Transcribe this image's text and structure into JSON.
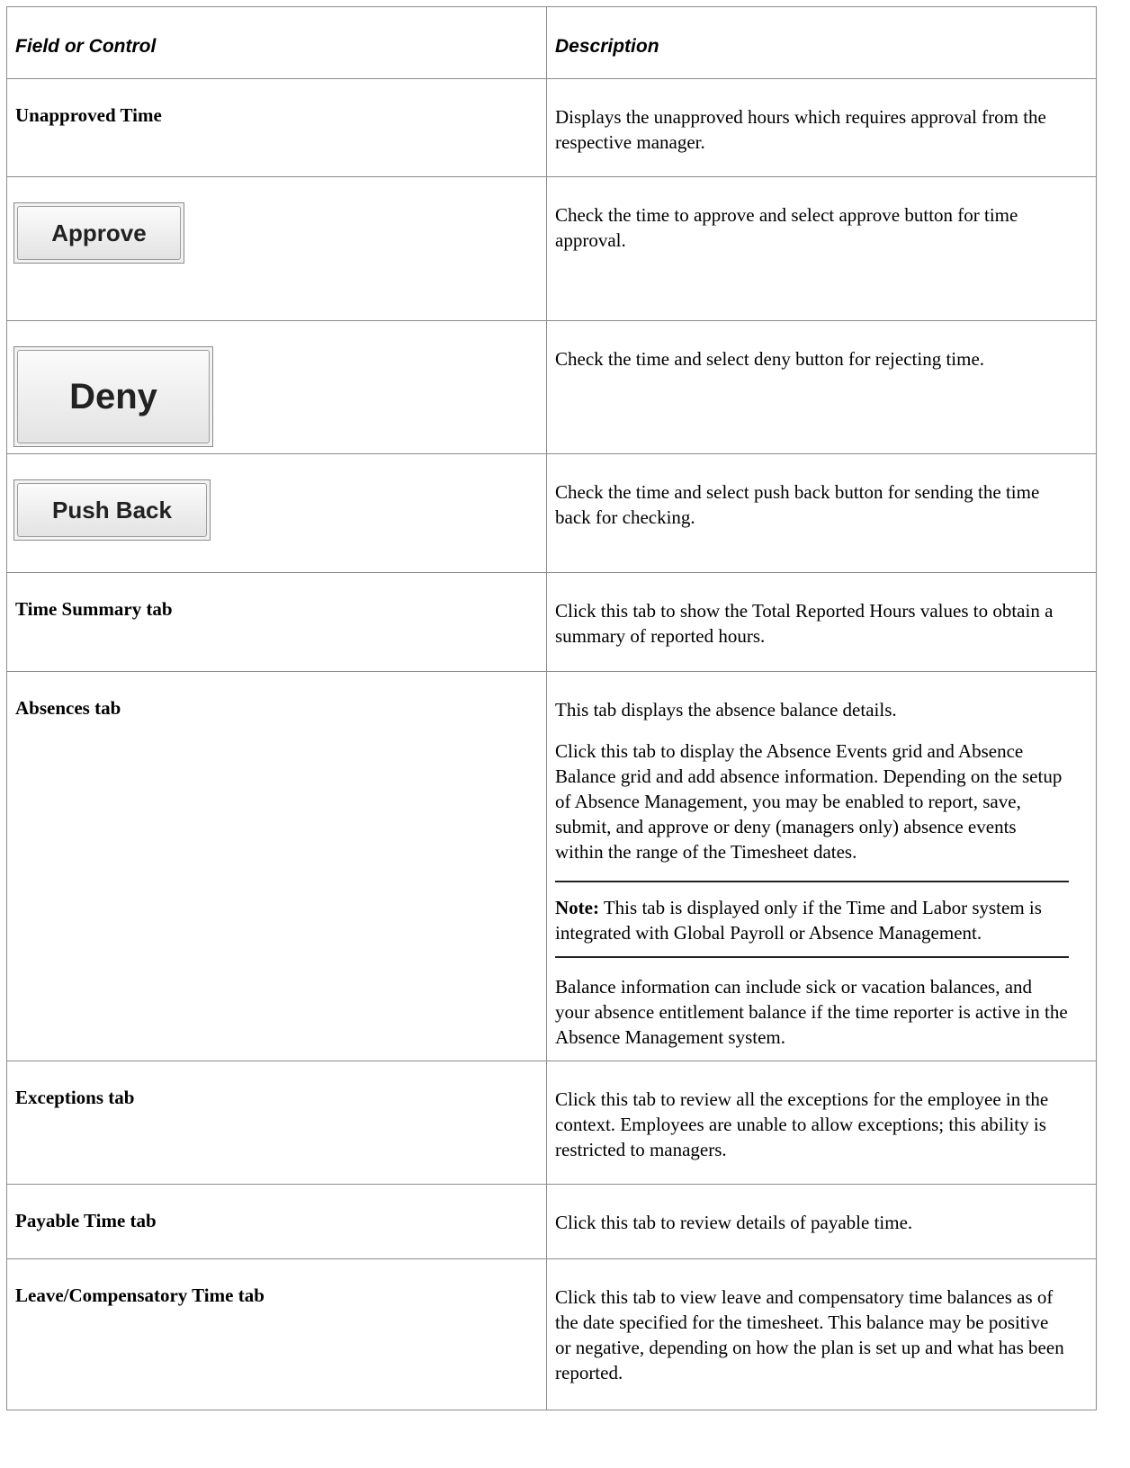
{
  "header": {
    "field": "Field or Control",
    "description": "Description"
  },
  "rows": [
    {
      "field": "Unapproved Time",
      "description": [
        "Displays the unapproved hours which requires approval from the respective manager."
      ]
    },
    {
      "button": "Approve",
      "description": [
        "Check the time to approve and select approve button for time approval."
      ]
    },
    {
      "button": "Deny",
      "description": [
        "Check the time and select deny button for rejecting time."
      ]
    },
    {
      "button": "Push Back",
      "description": [
        "Check the time and select push back button for sending the time back for checking."
      ]
    },
    {
      "field": "Time Summary tab",
      "description": [
        "Click this tab to show the Total Reported Hours values to obtain a summary of reported hours."
      ]
    },
    {
      "field": "Absences tab",
      "description": [
        "This tab displays the absence balance details.",
        "Click this tab to display the Absence Events grid and Absence Balance grid and add absence information. Depending on the setup of Absence Management, you may be enabled to report,  save, submit, and approve or deny (managers only) absence events within the range of the Timesheet dates."
      ],
      "note_label": "Note:",
      "note_text": " This tab is displayed only if the Time and Labor system is integrated with Global Payroll or Absence Management.",
      "after_note": "Balance information can include sick or vacation balances, and your absence entitlement balance if the time reporter is active in the Absence Management system."
    },
    {
      "field": "Exceptions tab",
      "description": [
        "Click this tab to review all the exceptions for the employee in the context. Employees are unable to allow exceptions; this ability is restricted to managers."
      ]
    },
    {
      "field": "Payable Time tab",
      "description": [
        "Click this tab to review details of payable time."
      ]
    },
    {
      "field": "Leave/Compensatory Time tab",
      "description": [
        "Click this tab to view leave and compensatory time balances as of the date specified for the timesheet. This balance may be positive or negative, depending on how the plan is set up and what has been reported."
      ]
    }
  ]
}
